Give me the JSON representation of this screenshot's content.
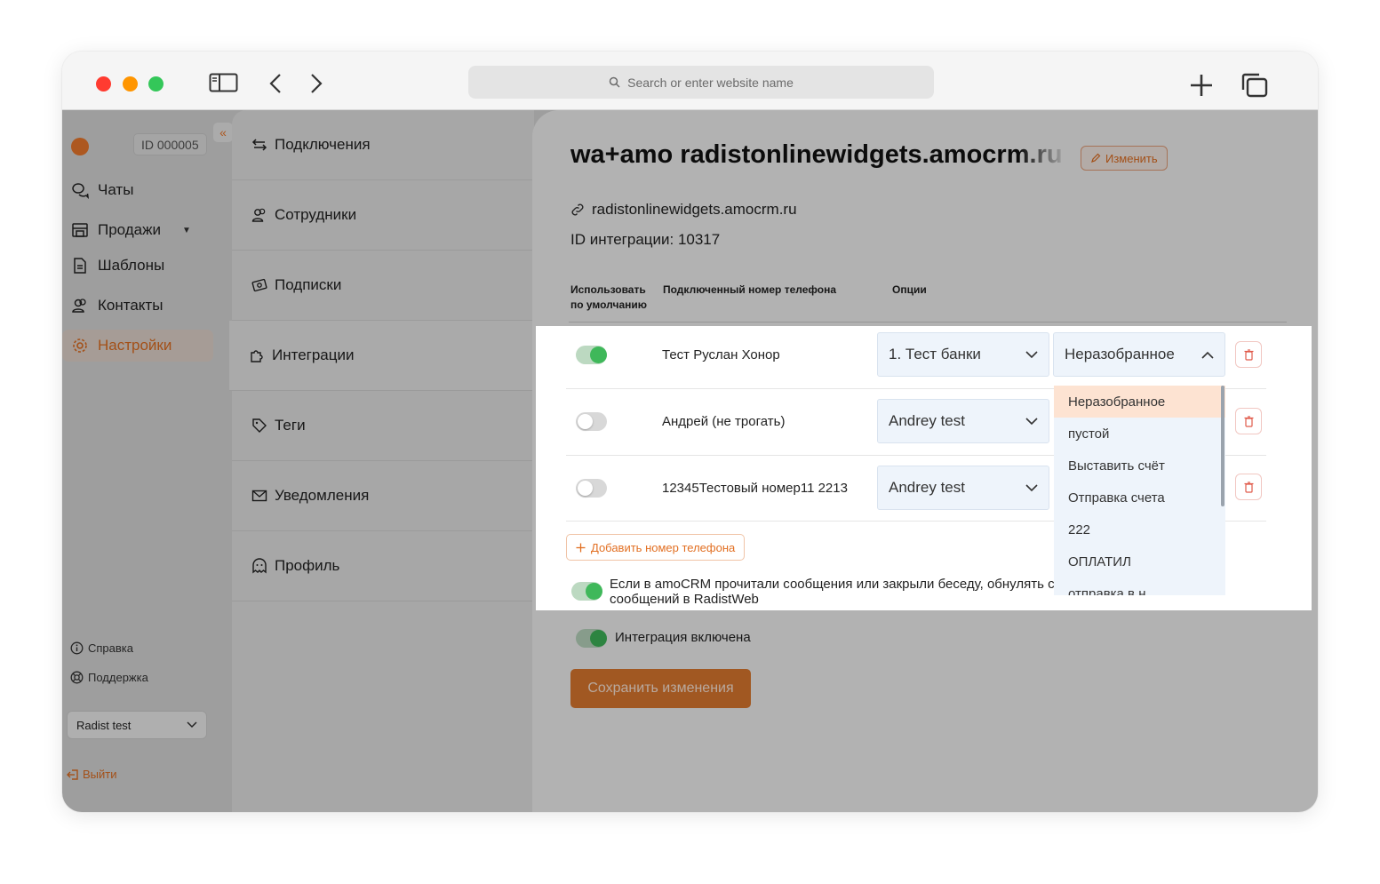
{
  "browser": {
    "address_placeholder": "Search or enter website name"
  },
  "sidebar": {
    "account_id": "ID 000005",
    "collapse": "«",
    "items": [
      {
        "label": "Чаты",
        "icon": "chat-icon"
      },
      {
        "label": "Продажи",
        "icon": "store-icon"
      },
      {
        "label": "Шаблоны",
        "icon": "document-icon"
      },
      {
        "label": "Контакты",
        "icon": "users-icon"
      },
      {
        "label": "Настройки",
        "icon": "gear-icon",
        "active": true
      }
    ],
    "help": "Справка",
    "support": "Поддержка",
    "workspace": "Radist test",
    "logout": "Выйти"
  },
  "settings_menu": {
    "items": [
      {
        "label": "Подключения",
        "icon": "arrows-icon"
      },
      {
        "label": "Сотрудники",
        "icon": "users-icon"
      },
      {
        "label": "Подписки",
        "icon": "money-icon"
      },
      {
        "label": "Интеграции",
        "icon": "puzzle-icon",
        "active": true
      },
      {
        "label": "Теги",
        "icon": "tag-icon"
      },
      {
        "label": "Уведомления",
        "icon": "mail-icon"
      },
      {
        "label": "Профиль",
        "icon": "ghost-icon"
      }
    ]
  },
  "integration": {
    "title": "wa+amo radistonlinewidgets.amocrm.ru",
    "edit_label": "Изменить",
    "domain": "radistonlinewidgets.amocrm.ru",
    "integration_id": "ID интеграции: 10317",
    "columns": {
      "default_line1": "Использовать",
      "default_line2": "по умолчанию",
      "phone": "Подключенный номер телефона",
      "options": "Опции"
    },
    "rows": [
      {
        "enabled": true,
        "phone": "Тест Руслан Хонор",
        "pipeline": "1. Тест банки",
        "status": "Неразобранное"
      },
      {
        "enabled": false,
        "phone": "Андрей (не трогать)",
        "pipeline": "Andrey test"
      },
      {
        "enabled": false,
        "phone": "12345Тестовый номер11 2213",
        "pipeline": "Andrey test"
      }
    ],
    "add_phone": "Добавить номер телефона",
    "reset_text": "Если в amoCRM прочитали сообщения или закрыли беседу, обнулять счётчик непрочитанных сообщений в RadistWeb",
    "reset_enabled": true,
    "integration_enabled_label": "Интеграция включена",
    "integration_enabled": true,
    "save_label": "Сохранить изменения"
  },
  "status_dropdown": {
    "options": [
      "Неразобранное",
      "пустой",
      "Выставить счёт",
      "Отправка счета",
      "222",
      "ОПЛАТИЛ",
      "отправка в н..."
    ],
    "selected": "Неразобранное"
  },
  "colors": {
    "accent": "#e26f22",
    "toggle_on": "#3fb85a",
    "select_bg": "#eef4fb"
  }
}
